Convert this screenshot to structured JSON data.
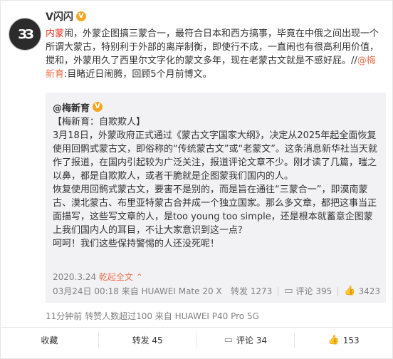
{
  "post": {
    "username": "V闪闪",
    "badge_glyph": "V",
    "avatar_text": "ЗЗ",
    "text_red": "内蒙",
    "text_main": "闹，外蒙企图搞三蒙合一，最符合日本和西方搞事，毕竟在中俄之间出现一个所谓大蒙古，特别利于外部的离岸制衡，即使行不成，一直闹也有很高利用价值，搅和，外蒙用久了西里尔文字化的蒙文多年，现在老蒙古文就是不感好屁。//",
    "mention": "@梅新育",
    "text_tail": ":目睹近日闹腾，回顾5个月前博文。",
    "footer": "11分钟前 转赞人数超过100  来自 HUAWEI P40 Pro 5G"
  },
  "repost": {
    "user": "@梅新育",
    "paragraphs": [
      "【梅新育：自欺欺人】",
      "3月18日，外蒙政府正式通过《蒙古文字国家大纲》，决定从2025年起全面恢复使用回鹘式蒙古文，即俗称的“传统蒙古文”或“老蒙文”。这条消息新华社当天就作了报道，在国内引起较为广泛关注，报道评论文章不少。刚才读了几篇，嗤之以鼻，都是自欺欺人，或者干脆就是企图蒙我们国内的人。",
      "恢复使用回鹘式蒙古文，要害不是别的，而是旨在通往“三蒙合一”，即漠南蒙古、漠北蒙古、布里亚特蒙古合并成一个独立国家。那么多文章，都把这事当正面描写，这些写文章的人，是too young too simple，还是根本就蓄意企图蒙上我们国内人的耳目，不让大家意识到这一点？",
      "呵呵！我们这些保持警惕的人还没死呢！"
    ],
    "date": "2020.3.24",
    "expand_label": "乾起全文",
    "meta_source": "03月24日 00:18 来自 HUAWEI Mate 20 X",
    "repost_label": "转发 1273",
    "comment_label": "评论 395",
    "like_count": "3423"
  },
  "actions": {
    "favorite": "收藏",
    "forward": "转发 45",
    "comment": "评论 34",
    "like": "153"
  },
  "colors": {
    "accent": "#eb7350",
    "highlight_red": "#e8331f",
    "badge": "#f6a623",
    "repost_bg": "#f2f2f5"
  }
}
